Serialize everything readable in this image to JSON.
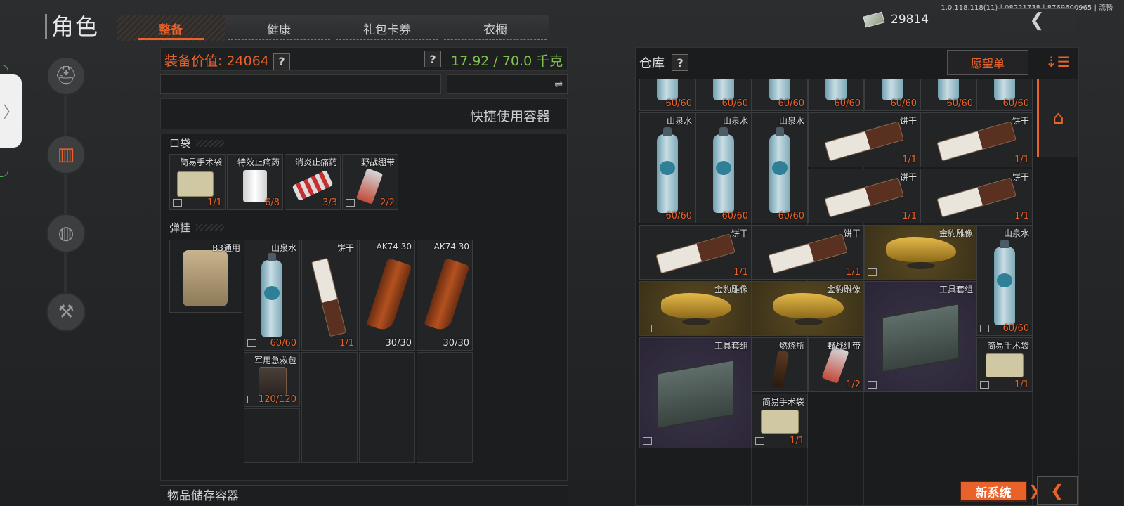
{
  "version": "1.0.118.118(11) | 08221738 | 8769600965 | 流畅",
  "page_title": "角色",
  "tabs": [
    {
      "label": "整备",
      "active": true
    },
    {
      "label": "健康",
      "active": false
    },
    {
      "label": "礼包卡券",
      "active": false
    },
    {
      "label": "衣橱",
      "active": false
    }
  ],
  "money": "29814",
  "left_panel": {
    "equip_value_label": "装备价值:",
    "equip_value": "24064",
    "help": "?",
    "weight": "17.92 / 70.0 千克",
    "swap_icon": "⇌",
    "quick_use": "快捷使用容器",
    "pocket_label": "口袋",
    "pockets": [
      {
        "name": "简易手术袋",
        "count": "1/1"
      },
      {
        "name": "特效止痛药",
        "count": "6/8"
      },
      {
        "name": "消炎止痛药",
        "count": "3/3"
      },
      {
        "name": "野战绷带",
        "count": "2/2"
      }
    ],
    "rig_label": "弹挂",
    "rig_name": "B3通用",
    "rig_items": [
      {
        "name": "山泉水",
        "count": "60/60"
      },
      {
        "name": "饼干",
        "count": "1/1"
      },
      {
        "name": "AK74 30",
        "count": "30/30"
      },
      {
        "name": "AK74 30",
        "count": "30/30"
      },
      {
        "name": "军用急救包",
        "count": "120/120"
      }
    ],
    "storage_label": "物品储存容器"
  },
  "right_panel": {
    "title": "仓库",
    "help": "?",
    "wishlist": "愿望单",
    "new_system": "新系统",
    "top_row_counts": [
      "60/60",
      "60/60",
      "60/60",
      "60/60",
      "60/60",
      "60/60",
      "60/60"
    ],
    "items": {
      "water": "山泉水",
      "water_count": "60/60",
      "biscuit": "饼干",
      "biscuit_count": "1/1",
      "leopard": "金豹雕像",
      "toolbox": "工具套组",
      "molotov": "燃烧瓶",
      "bandage": "野战绷带",
      "bandage_count": "1/2",
      "surgery": "简易手术袋",
      "surgery_count": "1/1"
    }
  },
  "colors": {
    "accent": "#e8622a",
    "weight_green": "#7fc24b"
  }
}
